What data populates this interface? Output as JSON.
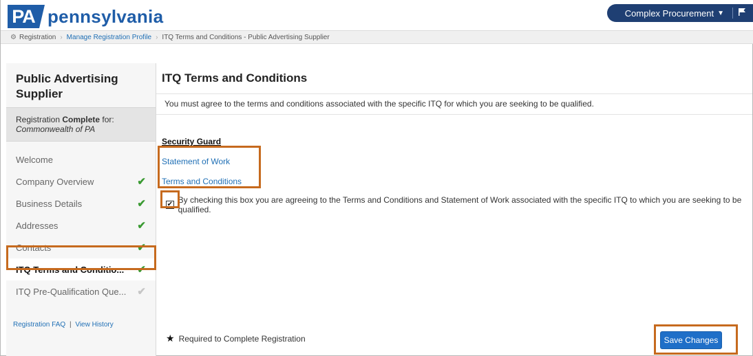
{
  "brand": {
    "abbrev": "PA",
    "name": "pennsylvania",
    "color": "#1f5da8"
  },
  "topbar": {
    "menu_label": "Complex Procurement",
    "caret_icon": "▼",
    "flag_icon": "flag-icon"
  },
  "breadcrumb": {
    "root": "Registration",
    "link": "Manage Registration Profile",
    "current": "ITQ Terms and Conditions - Public Advertising Supplier"
  },
  "sidebar": {
    "title": "Public Advertising Supplier",
    "status_prefix": "Registration",
    "status_bold": "Complete",
    "status_suffix": "for:",
    "org": "Commonwealth of PA",
    "items": [
      {
        "label": "Welcome",
        "check": ""
      },
      {
        "label": "Company Overview",
        "check": "✔"
      },
      {
        "label": "Business Details",
        "check": "✔"
      },
      {
        "label": "Addresses",
        "check": "✔"
      },
      {
        "label": "Contacts",
        "check": "✔"
      },
      {
        "label": "ITQ Terms and Conditio...",
        "check": "✔"
      },
      {
        "label": "ITQ Pre-Qualification Que...",
        "check": "✔"
      }
    ],
    "footer_faq": "Registration FAQ",
    "footer_sep": "|",
    "footer_history": "View History"
  },
  "main": {
    "title": "ITQ Terms and Conditions",
    "instruction": "You must agree to the terms and conditions associated with the specific ITQ for which you are seeking to be qualified.",
    "section_head": "Security Guard",
    "link_sow": "Statement of Work",
    "link_terms": "Terms and Conditions",
    "agree_text": "By checking this box you are agreeing to the Terms and Conditions and Statement of Work associated with the specific ITQ to which you are seeking to be qualified.",
    "checkbox_mark": "✔",
    "required_star": "★",
    "required_text": "Required to Complete Registration",
    "save_label": "Save Changes"
  },
  "colors": {
    "accent": "#1f6fb5",
    "highlight": "#c66a1e",
    "check": "#3a9a32"
  }
}
